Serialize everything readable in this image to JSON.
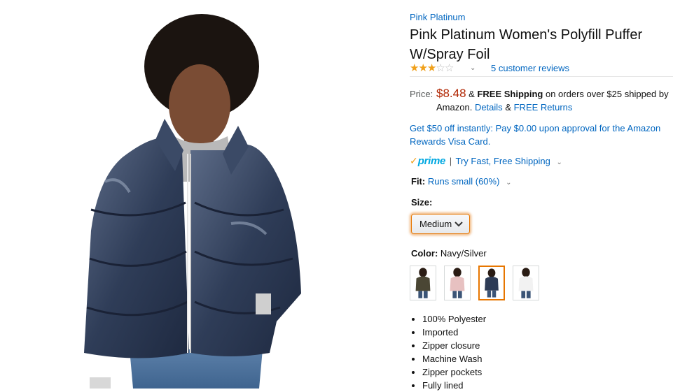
{
  "product": {
    "brand": "Pink Platinum",
    "title": "Pink Platinum Women's Polyfill Puffer W/Spray Foil",
    "rating": {
      "stars_filled": 3,
      "stars_total": 5,
      "reviews_label": "5 customer reviews"
    },
    "price": {
      "label": "Price:",
      "value": "$8.48",
      "amp": "&",
      "free_shipping": "FREE Shipping",
      "shipping_note_1": "on orders over $25 shipped by",
      "shipping_note_2": "Amazon.",
      "details_link": "Details",
      "amp2": "&",
      "free_returns_link": "FREE Returns"
    },
    "promo": "Get $50 off instantly: Pay $0.00 upon approval for the Amazon Rewards Visa Card.",
    "prime": {
      "word": "prime",
      "separator": "|",
      "link": "Try Fast, Free Shipping"
    },
    "fit": {
      "label": "Fit:",
      "value": "Runs small (60%)"
    },
    "size": {
      "label": "Size:",
      "selected": "Medium"
    },
    "color": {
      "label": "Color:",
      "selected": "Navy/Silver",
      "swatches": [
        {
          "name": "Olive",
          "color": "#4a4634"
        },
        {
          "name": "Blush",
          "color": "#e7c1c1"
        },
        {
          "name": "Navy/Silver",
          "color": "#2d3b55"
        },
        {
          "name": "White",
          "color": "#f2f2f2"
        }
      ]
    },
    "bullets": [
      "100% Polyester",
      "Imported",
      "Zipper closure",
      "Machine Wash",
      "Zipper pockets",
      "Fully lined"
    ]
  },
  "colors": {
    "link": "#0066c0",
    "price": "#b12704",
    "star": "#f0a01a",
    "prime": "#00a8e1",
    "selected_outline": "#e77600"
  }
}
